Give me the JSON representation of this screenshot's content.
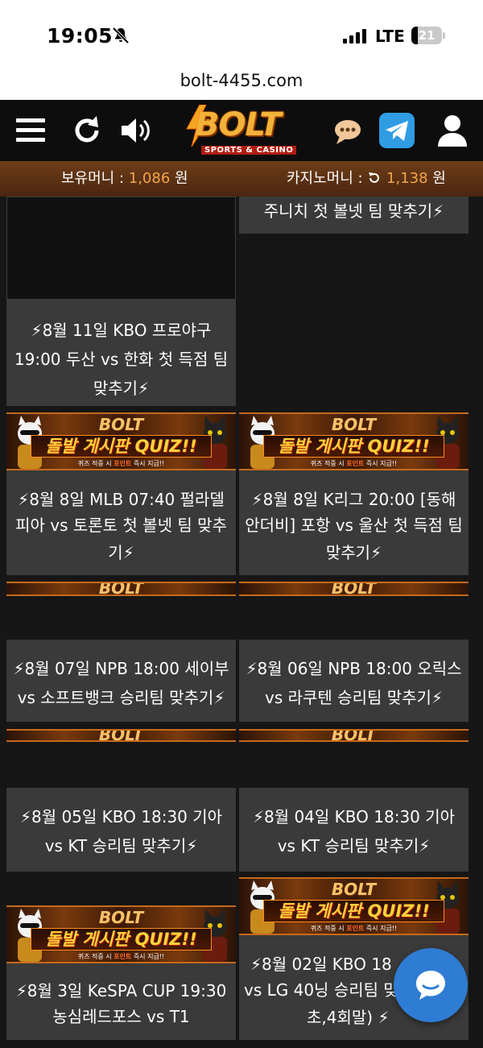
{
  "status_bar": {
    "time": "19:05",
    "network": "LTE",
    "battery": "21"
  },
  "browser": {
    "url": "bolt-4455.com"
  },
  "header": {
    "logo_text": "BOLT",
    "logo_sub": "SPORTS & CASINO",
    "icons": [
      "menu-icon",
      "refresh-icon",
      "sound-icon",
      "chat-bubble-icon",
      "telegram-icon",
      "user-icon"
    ]
  },
  "balance": {
    "money_label": "보유머니 : ",
    "money_value": "1,086",
    "money_unit": " 원",
    "casino_label": "카지노머니 : ",
    "casino_value": "1,138",
    "casino_unit": " 원"
  },
  "banner": {
    "logo": "BOLT",
    "title": "돌발 게시판 QUIZ!!",
    "sub_prefix": "퀴즈 적중 시 ",
    "sub_highlight": "포인트",
    "sub_suffix": " 즉시 지급!!"
  },
  "posts": [
    {
      "lines": [
        "주니치 첫 볼넷 팀 맞추기⚡"
      ]
    },
    {
      "lines": [
        "⚡8월 11일 KBO 프로야구",
        "19:00 두산 vs 한화 첫 득점 팀",
        "맞추기⚡"
      ]
    },
    {
      "lines": [
        "⚡8월 8일 MLB 07:40 펄라델",
        "피아 vs 토론토 첫 볼넷 팀 맞추",
        "기⚡"
      ]
    },
    {
      "lines": [
        "⚡8월 8일 K리그 20:00 [동해",
        "안더비] 포항 vs 울산 첫 득점 팀",
        "맞추기⚡"
      ]
    },
    {
      "lines": [
        "⚡8월 07일 NPB 18:00 세이부",
        "vs 소프트뱅크 승리팀 맞추기⚡"
      ]
    },
    {
      "lines": [
        "⚡8월 06일 NPB 18:00 오릭스",
        "vs 라쿠텐 승리팀 맞추기⚡"
      ]
    },
    {
      "lines": [
        "⚡8월 05일 KBO 18:30 기아",
        "vs KT 승리팀 맞추기⚡"
      ]
    },
    {
      "lines": [
        "⚡8월 04일 KBO 18:30 기아",
        "vs KT 승리팀 맞추기⚡"
      ]
    },
    {
      "lines": [
        "⚡8월 3일 KeSPA CUP 19:30",
        "농심레드포스 vs T1"
      ]
    },
    {
      "lines": [
        "⚡8월 02일 KBO 18",
        "vs LG 40닝 승리팀 맞",
        "초,4회말) ⚡"
      ]
    }
  ],
  "colors": {
    "accent": "#f3a44a",
    "card_bg": "#3a3a3a",
    "page_bg": "#161616",
    "chat": "#2e7cd3"
  }
}
